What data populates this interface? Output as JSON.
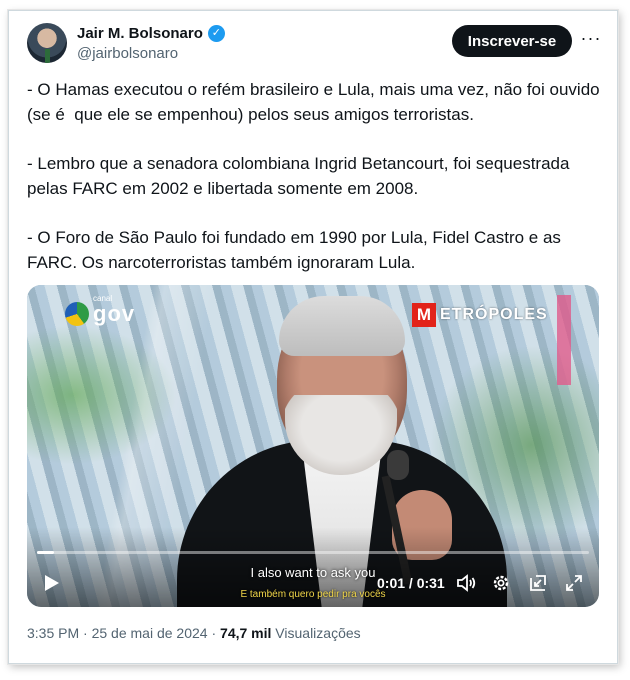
{
  "author": {
    "name": "Jair M. Bolsonaro",
    "handle": "@jairbolsonaro",
    "verified_icon": "verified-badge-icon",
    "accent": "#1d9bf0"
  },
  "actions": {
    "subscribe_label": "Inscrever-se",
    "more_icon": "more-options-icon",
    "more_glyph": "···"
  },
  "tweet": {
    "paragraphs": [
      "- O Hamas executou o refém brasileiro e Lula, mais uma vez, não foi ouvido (se é  que ele se empenhou) pelos seus amigos terroristas.",
      "- Lembro que a senadora colombiana Ingrid Betancourt, foi sequestrada pelas FARC em 2002 e libertada somente em 2008.",
      "- O Foro de São Paulo foi fundado em 1990 por Lula, Fidel Castro e as FARC. Os narcoterroristas também ignoraram Lula."
    ]
  },
  "video": {
    "logo_left_small": "canal",
    "logo_left": "gov",
    "logo_right_letter": "M",
    "logo_right": "ETRÓPOLES",
    "caption_en": "I also want to ask you",
    "caption_pt": "E também quero pedir pra vocês",
    "time": "0:01 / 0:31",
    "progress": 0.03,
    "icons": [
      "play-icon",
      "volume-icon",
      "settings-icon",
      "pip-icon",
      "fullscreen-icon"
    ]
  },
  "meta": {
    "time": "3:35 PM",
    "sep1": " · ",
    "date": "25 de mai de 2024",
    "sep2": " · ",
    "views_count": "74,7 mil",
    "views_label": " Visualizações"
  }
}
